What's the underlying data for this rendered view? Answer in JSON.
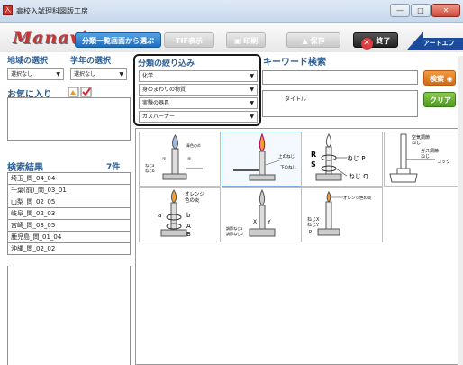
{
  "window": {
    "title": "高校入試理科図版工房",
    "icon_glyph": "入",
    "minimize_glyph": "—",
    "maximize_glyph": "□",
    "close_glyph": "✕"
  },
  "toolbar": {
    "logo": "Manavi",
    "btn_list": "分類一覧画面から選ぶ",
    "btn_tif": "TIF表示",
    "btn_print": "印刷",
    "btn_save": "保存",
    "btn_exit": "終了",
    "brand": "アートエフ"
  },
  "filters": {
    "region_label": "地域の選択",
    "grade_label": "学年の選択",
    "region_value": "選択なし",
    "grade_value": "選択なし",
    "favorites_label": "お気に入り"
  },
  "category": {
    "label": "分類の絞り込み",
    "levels": [
      "化学",
      "身のまわりの物質",
      "実験の器具",
      "ガスバーナー"
    ]
  },
  "keyword": {
    "label": "キーワード検索",
    "search_button": "検索",
    "clear_button": "クリア",
    "title_field_label": "タイトル"
  },
  "results": {
    "label": "検索結果",
    "count": "7件",
    "items": [
      "埼玉_問_04_04",
      "千葉(前)_問_03_01",
      "山梨_問_02_05",
      "岐阜_問_02_03",
      "宮崎_問_03_05",
      "鹿児島_問_01_04",
      "沖縄_問_02_02"
    ]
  },
  "thumbnails": {
    "t1": [
      "青色の炎",
      "①",
      "②",
      "ねじa",
      "ねじb"
    ],
    "t2": [
      "上のねじ",
      "下のねじ"
    ],
    "t3": [
      "R",
      "S",
      "ねじ P",
      "ねじ Q"
    ],
    "t4": [
      "空気調節",
      "ねじ",
      "ガス調節",
      "ねじ",
      "コック"
    ],
    "t5": [
      "オレンジ",
      "色の炎",
      "a",
      "b",
      "A",
      "B"
    ],
    "t6": [
      "X",
      "Y",
      "調節ねじa",
      "調節ねじb"
    ],
    "t7": [
      "オレンジ色の炎",
      "ねじX",
      "ねじY",
      "P"
    ]
  }
}
